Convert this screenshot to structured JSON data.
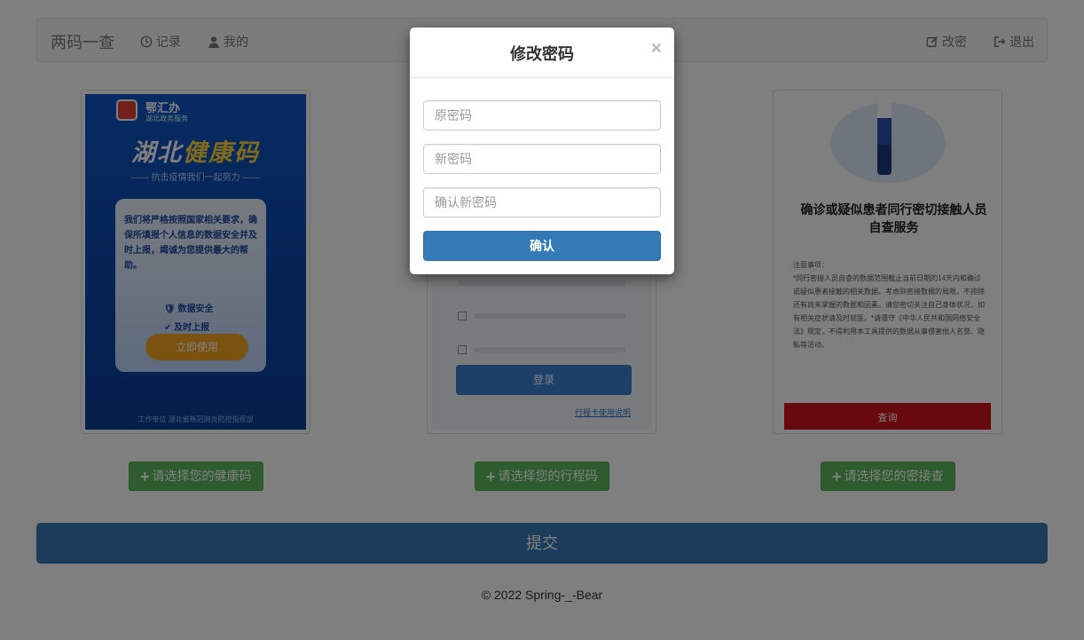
{
  "navbar": {
    "brand": "两码一查",
    "links": {
      "records": "记录",
      "mine": "我的",
      "change": "改密",
      "logout": "退出"
    }
  },
  "cards": {
    "health": {
      "logo_name": "鄂汇办",
      "logo_sub": "湖北政务服务",
      "title_a": "湖北",
      "title_b": "健康码",
      "slogan": "—— 抗击疫情我们一起努力 ——",
      "promise": "我们将严格按照国家相关要求，确保所填报个人信息的数据安全并及时上报，竭诚为您提供最大的帮助。",
      "check1": "数据安全",
      "check2": "及时上报",
      "use_button": "立即使用",
      "footer": "工作单位    湖北省新冠肺炎防控指挥部"
    },
    "itinerary": {
      "login": "登录",
      "link": "行程卡使用说明"
    },
    "contact": {
      "heading": "确诊或疑似患者同行密切接触人员自查服务",
      "notes_title": "注意事项：",
      "notes": "*同行密接人员自查的数据范围截止当前日期的14天内和确诊或疑似患者接触的相关数据。考虑到密接数据的局限，不排除还有尚未掌握的数据和因素。请您密切关注自己身体状况，如有相关症状请及时就医。*请遵守《中华人民共和国网络安全法》规定，不得利用本工具提供的数据从事侵害他人名誉、隐私等活动。",
      "query_button": "查询"
    }
  },
  "buttons": {
    "choose_health": "请选择您的健康码",
    "choose_itinerary": "请选择您的行程码",
    "choose_contact": "请选择您的密接查",
    "submit": "提交"
  },
  "footer": "© 2022 Spring-_-Bear",
  "modal": {
    "title": "修改密码",
    "close": "×",
    "old_password_placeholder": "原密码",
    "new_password_placeholder": "新密码",
    "confirm_password_placeholder": "确认新密码",
    "confirm": "确认"
  },
  "colors": {
    "primary": "#337ab7",
    "success": "#5cb85c",
    "navbar_bg": "#f8f8f8"
  }
}
